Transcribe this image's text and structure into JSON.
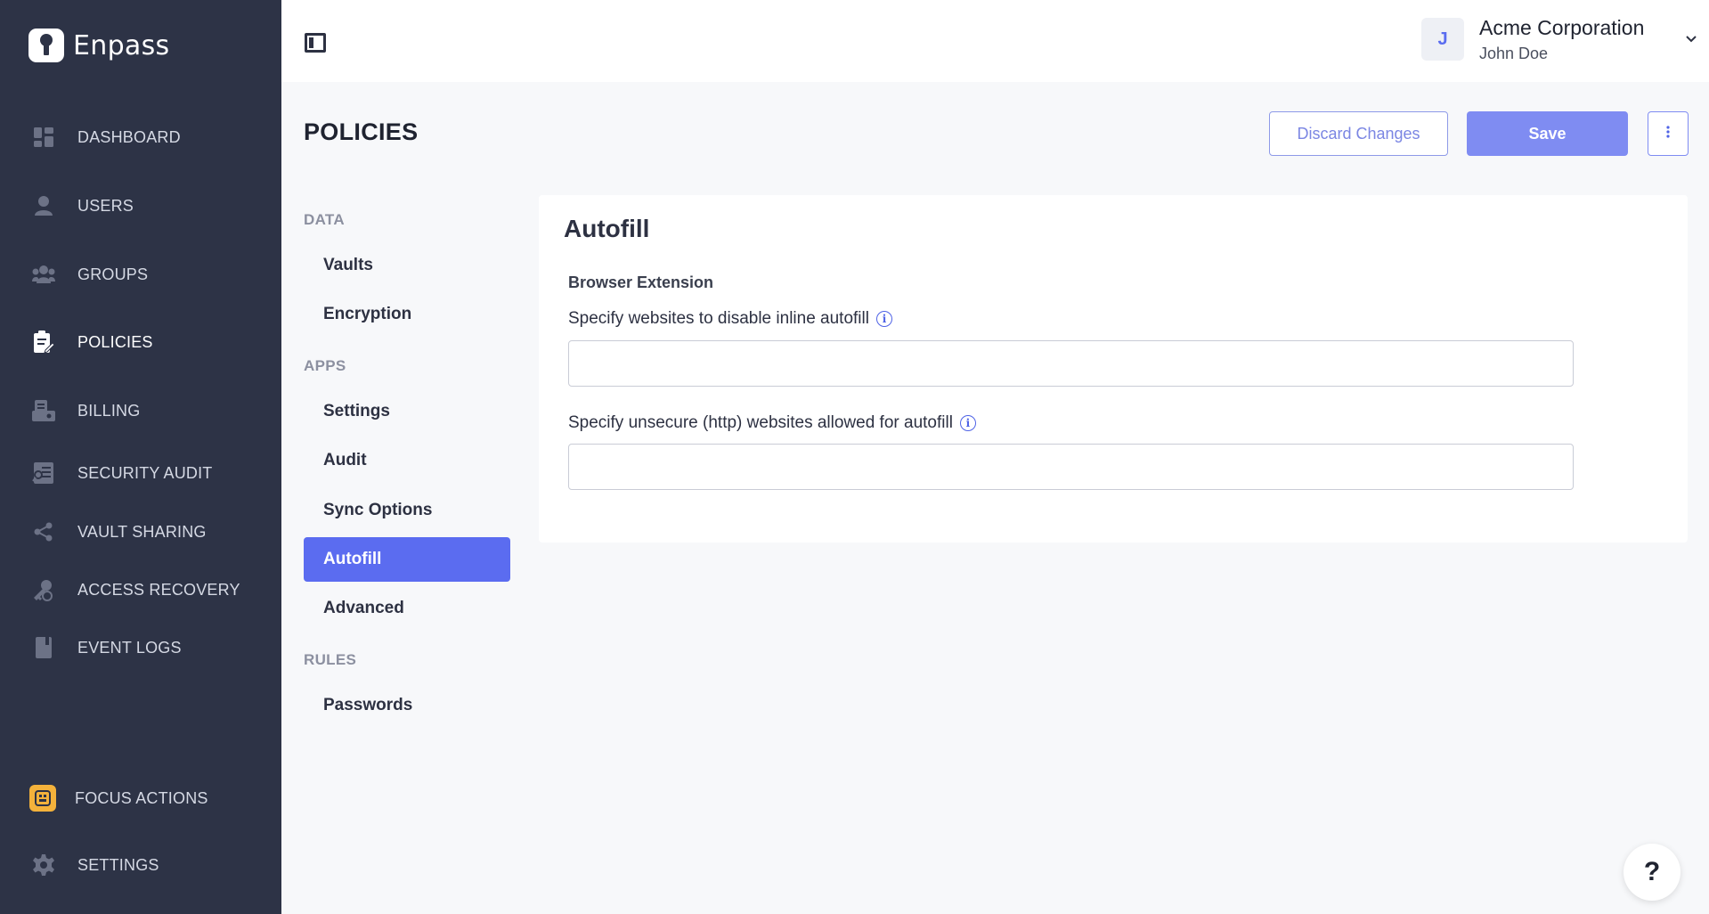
{
  "brand": {
    "name": "Enpass"
  },
  "sidebar": {
    "items": [
      {
        "label": "DASHBOARD",
        "icon": "dashboard-icon"
      },
      {
        "label": "USERS",
        "icon": "user-icon"
      },
      {
        "label": "GROUPS",
        "icon": "groups-icon"
      },
      {
        "label": "POLICIES",
        "icon": "policies-icon",
        "active": true
      },
      {
        "label": "BILLING",
        "icon": "billing-icon"
      },
      {
        "label": "SECURITY AUDIT",
        "icon": "security-audit-icon"
      },
      {
        "label": "VAULT SHARING",
        "icon": "share-icon"
      },
      {
        "label": "ACCESS RECOVERY",
        "icon": "access-recovery-icon"
      },
      {
        "label": "EVENT LOGS",
        "icon": "event-logs-icon"
      }
    ],
    "bottom": [
      {
        "label": "FOCUS ACTIONS",
        "icon": "focus-actions-icon"
      },
      {
        "label": "SETTINGS",
        "icon": "gear-icon"
      }
    ]
  },
  "topbar": {
    "org_name": "Acme Corporation",
    "user_name": "John Doe",
    "avatar_initial": "J"
  },
  "header": {
    "title": "POLICIES",
    "discard_label": "Discard Changes",
    "save_label": "Save"
  },
  "policy_nav": {
    "sections": [
      {
        "heading": "DATA",
        "items": [
          "Vaults",
          "Encryption"
        ]
      },
      {
        "heading": "APPS",
        "items": [
          "Settings",
          "Audit",
          "Sync Options",
          "Autofill",
          "Advanced"
        ]
      },
      {
        "heading": "RULES",
        "items": [
          "Passwords"
        ]
      }
    ],
    "active": "Autofill"
  },
  "card": {
    "title": "Autofill",
    "section_label": "Browser Extension",
    "fields": [
      {
        "label": "Specify websites to disable inline autofill",
        "value": "",
        "placeholder": ""
      },
      {
        "label": "Specify unsecure (http) websites allowed for autofill",
        "value": "",
        "placeholder": ""
      }
    ]
  },
  "help": {
    "label": "?"
  },
  "colors": {
    "sidebar_bg": "#2d3346",
    "accent": "#5b6cf0",
    "save_bg": "#7f8cf2",
    "focus_icon_bg": "#f4b23b"
  }
}
